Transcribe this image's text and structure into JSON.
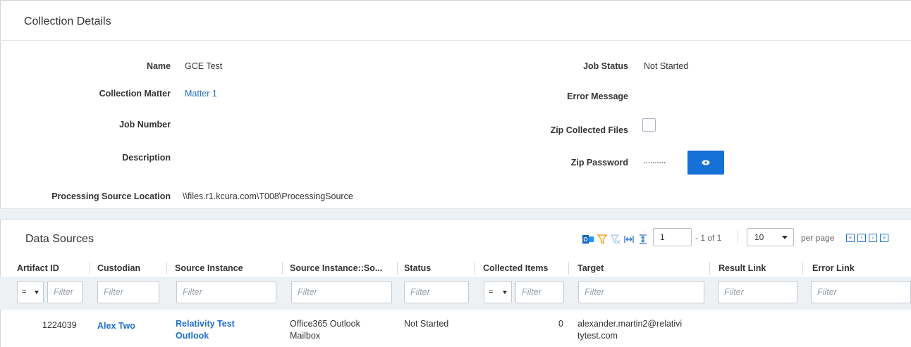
{
  "collection_details": {
    "title": "Collection Details",
    "fields_left": [
      {
        "label": "Name",
        "value": "GCE Test"
      },
      {
        "label": "Collection Matter",
        "value": "Matter 1"
      },
      {
        "label": "Job Number",
        "value": ""
      },
      {
        "label": "Description",
        "value": ""
      },
      {
        "label": "Processing Source Location",
        "value": "\\\\files.r1.kcura.com\\T008\\ProcessingSource"
      }
    ],
    "fields_right": [
      {
        "label": "Job Status",
        "value": "Not Started"
      },
      {
        "label": "Error Message",
        "value": ""
      },
      {
        "label": "Zip Collected Files",
        "checked": false
      },
      {
        "label": "Zip Password",
        "value": "··········"
      }
    ],
    "link_color": "#1f6fd1",
    "button_color": "#1670d6"
  },
  "data_sources": {
    "title": "Data Sources",
    "toolbar_icons": [
      "outlook-icon",
      "filter-icon",
      "clear-filter-icon",
      "fit-columns-icon",
      "fit-rows-icon"
    ],
    "pager": {
      "page": "1",
      "of_text": "- 1 of 1",
      "per_page": "10",
      "per_page_label": "per page",
      "nav": [
        "«",
        "‹",
        "›",
        "»"
      ]
    },
    "columns": [
      "Artifact ID",
      "Custodian",
      "Source Instance",
      "Source Instance::So...",
      "Status",
      "Collected Items",
      "Target",
      "Result Link",
      "Error Link"
    ],
    "filters": {
      "placeholder": "Filter",
      "operator": "="
    },
    "rows": [
      {
        "artifact_id": "1224039",
        "custodian": "Alex Two",
        "source_instance_line1": "Relativity Test",
        "source_instance_line2": "Outlook",
        "source_type_line1": "Office365 Outlook",
        "source_type_line2": "Mailbox",
        "status": "Not Started",
        "collected_items": "0",
        "target_line1": "alexander.martin2@relativi",
        "target_line2": "tytest.com",
        "result_link": "",
        "error_link": ""
      }
    ]
  }
}
